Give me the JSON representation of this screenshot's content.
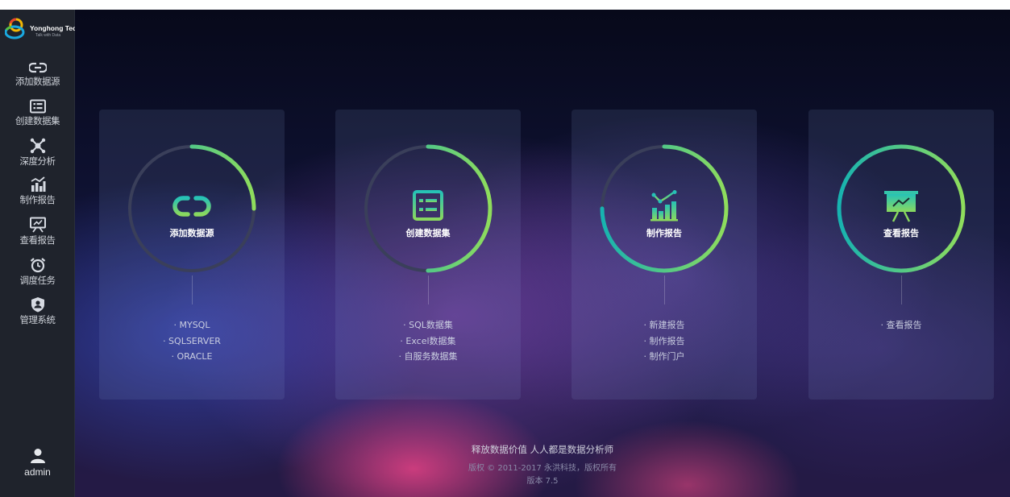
{
  "brand": {
    "name": "Yonghong Tech",
    "tagline": "Talk with Data"
  },
  "sidebar": {
    "items": [
      {
        "label": "添加数据源",
        "icon": "link-icon"
      },
      {
        "label": "创建数据集",
        "icon": "dataset-list-icon"
      },
      {
        "label": "深度分析",
        "icon": "network-analysis-icon"
      },
      {
        "label": "制作报告",
        "icon": "bar-chart-icon"
      },
      {
        "label": "查看报告",
        "icon": "presentation-icon"
      },
      {
        "label": "调度任务",
        "icon": "alarm-clock-icon"
      },
      {
        "label": "管理系统",
        "icon": "shield-user-icon"
      }
    ],
    "user": {
      "name": "admin",
      "icon": "user-icon"
    }
  },
  "cards": [
    {
      "title": "添加数据源",
      "icon": "link-icon",
      "progress": 0.25,
      "links": [
        "· MYSQL",
        "· SQLSERVER",
        "· ORACLE"
      ]
    },
    {
      "title": "创建数据集",
      "icon": "dataset-list-icon",
      "progress": 0.5,
      "links": [
        "· SQL数据集",
        "· Excel数据集",
        "· 自服务数据集"
      ]
    },
    {
      "title": "制作报告",
      "icon": "bar-chart-icon",
      "progress": 0.75,
      "links": [
        "· 新建报告",
        "· 制作报告",
        "· 制作门户"
      ]
    },
    {
      "title": "查看报告",
      "icon": "presentation-icon",
      "progress": 1.0,
      "links": [
        "· 查看报告"
      ]
    }
  ],
  "footer": {
    "slogan": "释放数据价值 人人都是数据分析师",
    "copyright": "版权 © 2011-2017 永洪科技，版权所有",
    "version": "版本 7.5"
  },
  "colors": {
    "sidebar_bg": "#1f232c",
    "ring_start": "#17b3b0",
    "ring_end": "#8fdd5c",
    "track": "#3a3f5a"
  }
}
